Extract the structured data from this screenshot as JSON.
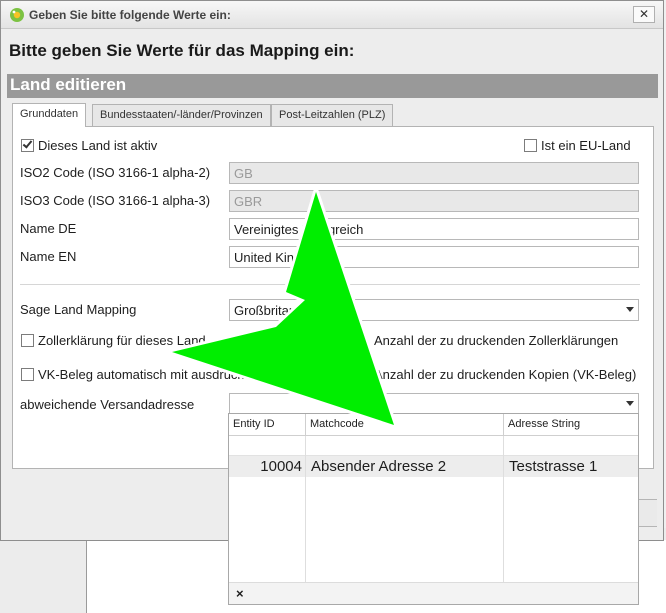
{
  "window": {
    "title": "Geben Sie bitte folgende Werte ein:",
    "close_glyph": "✕"
  },
  "header": {
    "text": "Bitte geben Sie Werte für das Mapping ein:"
  },
  "section": {
    "title": "Land editieren"
  },
  "tabs": [
    {
      "label": "Grunddaten",
      "active": true
    },
    {
      "label": "Bundesstaaten/-länder/Provinzen",
      "active": false
    },
    {
      "label": "Post-Leitzahlen (PLZ)",
      "active": false
    }
  ],
  "form": {
    "active_checkbox": {
      "label": "Dieses Land ist aktiv",
      "checked": true
    },
    "eu_checkbox": {
      "label": "Ist ein EU-Land",
      "checked": false
    },
    "iso2": {
      "label": "ISO2 Code (ISO 3166-1 alpha-2)",
      "value": "GB"
    },
    "iso3": {
      "label": "ISO3 Code (ISO 3166-1 alpha-3)",
      "value": "GBR"
    },
    "name_de": {
      "label": "Name DE",
      "value": "Vereinigtes Königreich"
    },
    "name_en": {
      "label": "Name EN",
      "value": "United Kingdom"
    },
    "sage_mapping": {
      "label": "Sage Land Mapping",
      "value": "Großbritannien"
    },
    "zoll_checkbox": {
      "label": "Zollerklärung für dieses Land",
      "checked": false
    },
    "zoll_count_label": "Anzahl der zu druckenden Zollerklärungen",
    "vk_checkbox": {
      "label": "VK-Beleg automatisch mit ausdrucken",
      "checked": false
    },
    "vk_count_label": "Anzahl der zu druckenden Kopien (VK-Beleg)",
    "versand": {
      "label": "abweichende Versandadresse",
      "value": ""
    }
  },
  "popup": {
    "columns": [
      "Entity ID",
      "Matchcode",
      "Adresse String"
    ],
    "rows": [
      {
        "entity_id": "10004",
        "matchcode": "Absender Adresse 2",
        "adresse": "Teststrasse 1"
      }
    ],
    "footer_close": "×"
  },
  "colors": {
    "arrow": "#00ee00",
    "section_bar": "#999999"
  }
}
